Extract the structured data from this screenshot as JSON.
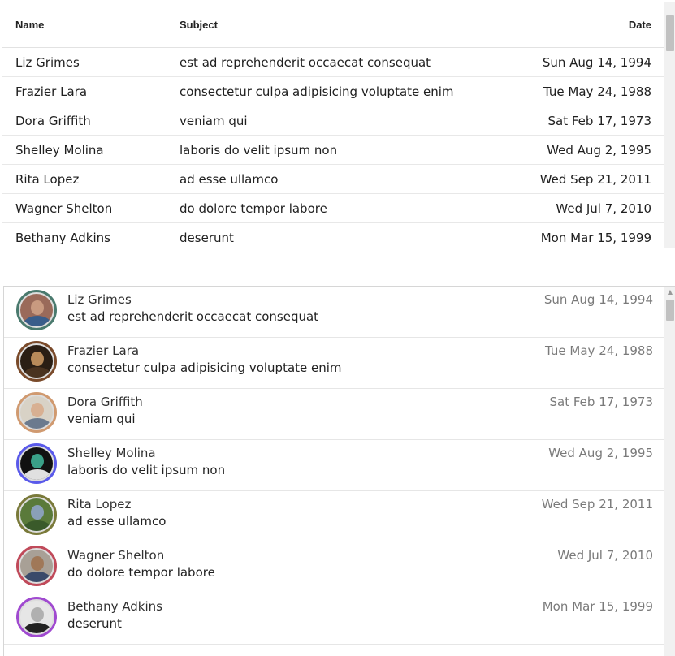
{
  "table": {
    "headers": {
      "name": "Name",
      "subject": "Subject",
      "date": "Date"
    },
    "rows": [
      {
        "name": "Liz Grimes",
        "subject": "est ad reprehenderit occaecat consequat",
        "date": "Sun Aug 14, 1994"
      },
      {
        "name": "Frazier Lara",
        "subject": "consectetur culpa adipisicing voluptate enim",
        "date": "Tue May 24, 1988"
      },
      {
        "name": "Dora Griffith",
        "subject": "veniam qui",
        "date": "Sat Feb 17, 1973"
      },
      {
        "name": "Shelley Molina",
        "subject": "laboris do velit ipsum non",
        "date": "Wed Aug 2, 1995"
      },
      {
        "name": "Rita Lopez",
        "subject": "ad esse ullamco",
        "date": "Wed Sep 21, 2011"
      },
      {
        "name": "Wagner Shelton",
        "subject": "do dolore tempor labore",
        "date": "Wed Jul 7, 2010"
      },
      {
        "name": "Bethany Adkins",
        "subject": "deserunt",
        "date": "Mon Mar 15, 1999"
      }
    ]
  },
  "list": {
    "items": [
      {
        "name": "Liz Grimes",
        "subject": "est ad reprehenderit occaecat consequat",
        "date": "Sun Aug 14, 1994",
        "ring": "#4a7a6e",
        "bg": "#9a6a5a",
        "skin": "#c99a80",
        "shirt": "#3a5d8a"
      },
      {
        "name": "Frazier Lara",
        "subject": "consectetur culpa adipisicing voluptate enim",
        "date": "Tue May 24, 1988",
        "ring": "#7a4a2a",
        "bg": "#2a1e14",
        "skin": "#b88a5a",
        "shirt": "#4a3320"
      },
      {
        "name": "Dora Griffith",
        "subject": "veniam qui",
        "date": "Sat Feb 17, 1973",
        "ring": "#d09a70",
        "bg": "#d8d2c6",
        "skin": "#d8b092",
        "shirt": "#6b7a8e"
      },
      {
        "name": "Shelley Molina",
        "subject": "laboris do velit ipsum non",
        "date": "Wed Aug 2, 1995",
        "ring": "#5a5aea",
        "bg": "#111111",
        "skin": "#3aa088",
        "shirt": "#e0e0e0"
      },
      {
        "name": "Rita Lopez",
        "subject": "ad esse ullamco",
        "date": "Wed Sep 21, 2011",
        "ring": "#7a7a3a",
        "bg": "#5a7a3a",
        "skin": "#8aa0b8",
        "shirt": "#3a5a2a"
      },
      {
        "name": "Wagner Shelton",
        "subject": "do dolore tempor labore",
        "date": "Wed Jul 7, 2010",
        "ring": "#c04a5a",
        "bg": "#a8a096",
        "skin": "#a07858",
        "shirt": "#3a4a6a"
      },
      {
        "name": "Bethany Adkins",
        "subject": "deserunt",
        "date": "Mon Mar 15, 1999",
        "ring": "#a04ad0",
        "bg": "#e6e6e6",
        "skin": "#b0b0b0",
        "shirt": "#222222"
      }
    ]
  }
}
